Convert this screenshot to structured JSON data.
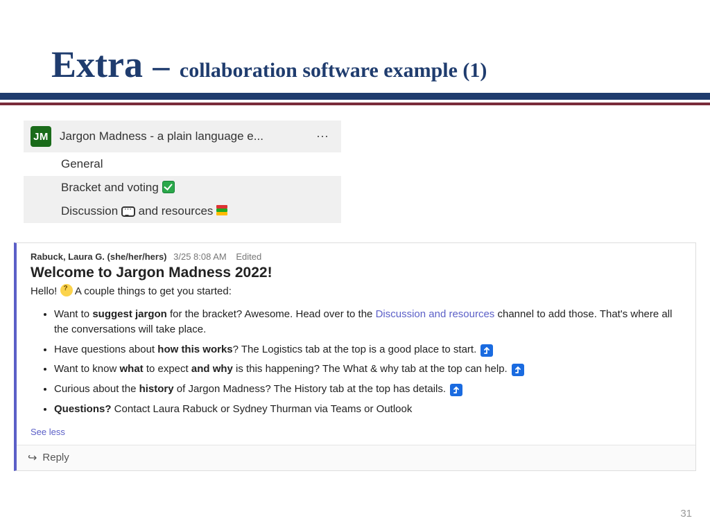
{
  "slide": {
    "title_large": "Extra",
    "title_dash": "–",
    "title_small": "collaboration software example (1)",
    "page_number": "31"
  },
  "team_panel": {
    "avatar_initials": "JM",
    "team_name": "Jargon Madness - a plain language e...",
    "channels": {
      "general": "General",
      "bracket": "Bracket and voting",
      "discussion_a": "Discussion",
      "discussion_b": "and resources"
    }
  },
  "message": {
    "author": "Rabuck, Laura G. (she/her/hers)",
    "timestamp": "3/25 8:08 AM",
    "edited": "Edited",
    "title": "Welcome to Jargon Madness 2022!",
    "intro_a": "Hello!",
    "intro_b": "A couple things to get you started:",
    "bullets": {
      "b1_a": "Want to ",
      "b1_strong": "suggest jargon",
      "b1_b": " for the bracket? Awesome. Head over to the ",
      "b1_link": "Discussion and resources",
      "b1_c": " channel to add those. That's where all the conversations will take place.",
      "b2_a": "Have questions about ",
      "b2_strong": "how this works",
      "b2_b": "? The Logistics tab at the top is a good place to start.",
      "b3_a": "Want to know ",
      "b3_strong1": "what",
      "b3_mid": " to expect ",
      "b3_strong2": "and why",
      "b3_b": " is this happening? The What & why tab at the top can help.",
      "b4_a": "Curious about the ",
      "b4_strong": "history",
      "b4_b": " of Jargon Madness? The History tab at the top has details.",
      "b5_strong": "Questions?",
      "b5_a": " Contact Laura Rabuck or Sydney Thurman via Teams or Outlook"
    },
    "see_less": "See less",
    "reply": "Reply"
  }
}
